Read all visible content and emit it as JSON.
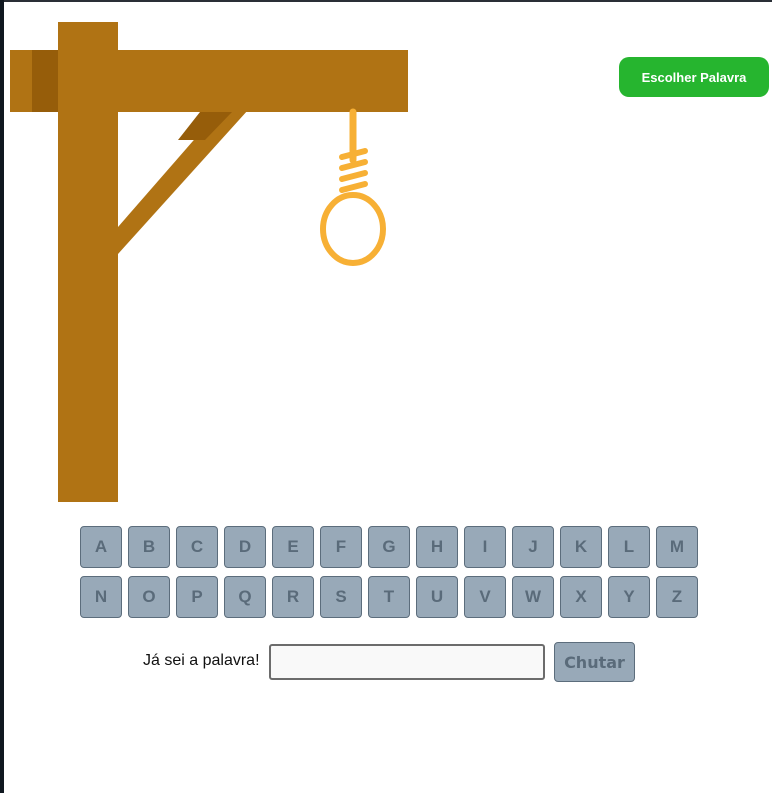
{
  "header": {
    "choose_word_label": "Escolher Palavra"
  },
  "gallows": {
    "wood_color": "#b07314",
    "wood_shadow_color": "#965d0a",
    "rope_color": "#f7b035"
  },
  "keyboard": {
    "rows": [
      [
        "A",
        "B",
        "C",
        "D",
        "E",
        "F",
        "G",
        "H",
        "I",
        "J",
        "K",
        "L",
        "M"
      ],
      [
        "N",
        "O",
        "P",
        "Q",
        "R",
        "S",
        "T",
        "U",
        "V",
        "W",
        "X",
        "Y",
        "Z"
      ]
    ],
    "disabled": true
  },
  "guess": {
    "label": "Já sei a palavra!",
    "input_value": "",
    "input_placeholder": "",
    "submit_label": "Chutar"
  },
  "colors": {
    "accent_green": "#26b52f",
    "disabled_button": "#98a9b8"
  }
}
